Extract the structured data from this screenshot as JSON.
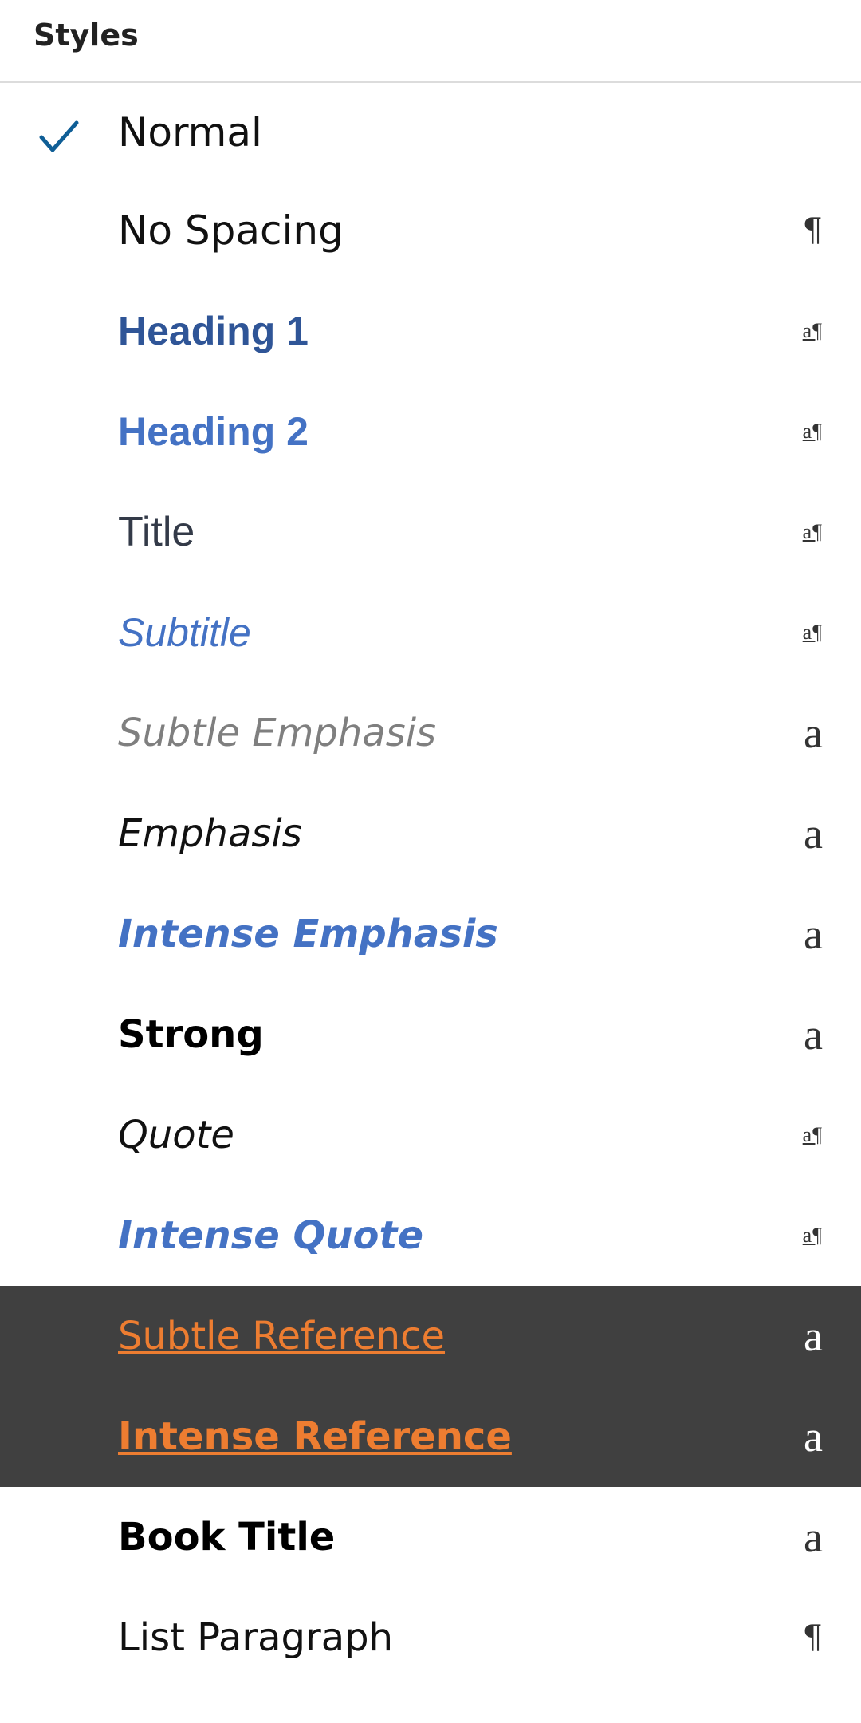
{
  "panel": {
    "title": "Styles",
    "selected": "Normal",
    "colors": {
      "check": "#0f5e96",
      "highlight_bg": "#404040",
      "heading1": "#2f5597",
      "accent_blue": "#4472c4",
      "accent_orange": "#ed7d31",
      "subtle_gray": "#7f7f7f"
    }
  },
  "styles": [
    {
      "label": "Normal",
      "type_icon": "check-icon",
      "glyph": ""
    },
    {
      "label": "No Spacing",
      "type_icon": "paragraph-style-icon",
      "glyph": "¶"
    },
    {
      "label": "Heading 1",
      "type_icon": "linked-style-icon",
      "glyph": "a¶"
    },
    {
      "label": "Heading 2",
      "type_icon": "linked-style-icon",
      "glyph": "a¶"
    },
    {
      "label": "Title",
      "type_icon": "linked-style-icon",
      "glyph": "a¶"
    },
    {
      "label": "Subtitle",
      "type_icon": "linked-style-icon",
      "glyph": "a¶"
    },
    {
      "label": "Subtle Emphasis",
      "type_icon": "character-style-icon",
      "glyph": "a"
    },
    {
      "label": "Emphasis",
      "type_icon": "character-style-icon",
      "glyph": "a"
    },
    {
      "label": "Intense Emphasis",
      "type_icon": "character-style-icon",
      "glyph": "a"
    },
    {
      "label": "Strong",
      "type_icon": "character-style-icon",
      "glyph": "a"
    },
    {
      "label": "Quote",
      "type_icon": "linked-style-icon",
      "glyph": "a¶"
    },
    {
      "label": "Intense Quote",
      "type_icon": "linked-style-icon",
      "glyph": "a¶"
    },
    {
      "label": "Subtle Reference",
      "type_icon": "character-style-icon",
      "glyph": "a"
    },
    {
      "label": "Intense Reference",
      "type_icon": "character-style-icon",
      "glyph": "a"
    },
    {
      "label": "Book Title",
      "type_icon": "character-style-icon",
      "glyph": "a"
    },
    {
      "label": "List Paragraph",
      "type_icon": "paragraph-style-icon",
      "glyph": "¶"
    }
  ]
}
